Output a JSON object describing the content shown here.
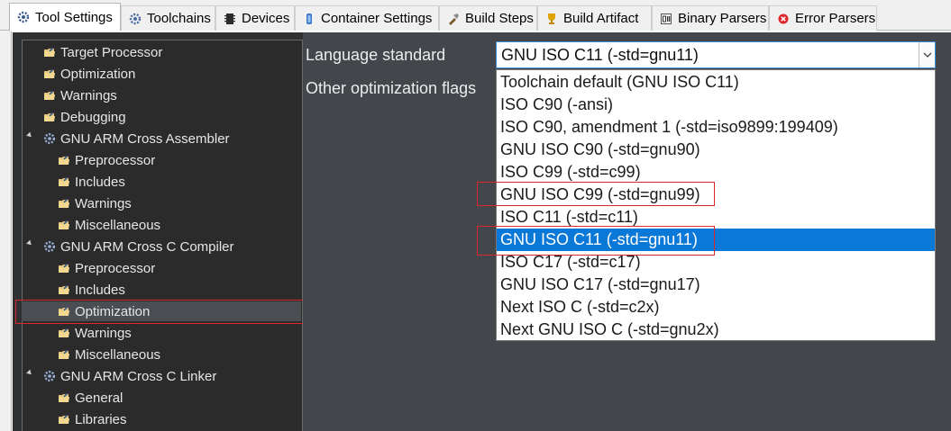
{
  "tabs": [
    {
      "label": "Tool Settings",
      "icon": "tool-settings-icon",
      "active": true
    },
    {
      "label": "Toolchains",
      "icon": "toolchains-icon"
    },
    {
      "label": "Devices",
      "icon": "devices-icon"
    },
    {
      "label": "Container Settings",
      "icon": "container-icon"
    },
    {
      "label": "Build Steps",
      "icon": "build-steps-icon"
    },
    {
      "label": "Build Artifact",
      "icon": "build-artifact-icon"
    },
    {
      "label": "Binary Parsers",
      "icon": "binary-parsers-icon"
    },
    {
      "label": "Error Parsers",
      "icon": "error-parsers-icon"
    }
  ],
  "tree": {
    "items": [
      {
        "label": "Target Processor",
        "level": 1
      },
      {
        "label": "Optimization",
        "level": 1
      },
      {
        "label": "Warnings",
        "level": 1
      },
      {
        "label": "Debugging",
        "level": 1
      },
      {
        "label": "GNU ARM Cross Assembler",
        "level": 0
      },
      {
        "label": "Preprocessor",
        "level": 2
      },
      {
        "label": "Includes",
        "level": 2
      },
      {
        "label": "Warnings",
        "level": 2
      },
      {
        "label": "Miscellaneous",
        "level": 2
      },
      {
        "label": "GNU ARM Cross C Compiler",
        "level": 0
      },
      {
        "label": "Preprocessor",
        "level": 2
      },
      {
        "label": "Includes",
        "level": 2
      },
      {
        "label": "Optimization",
        "level": 2,
        "selected": true
      },
      {
        "label": "Warnings",
        "level": 2
      },
      {
        "label": "Miscellaneous",
        "level": 2
      },
      {
        "label": "GNU ARM Cross C Linker",
        "level": 0
      },
      {
        "label": "General",
        "level": 2
      },
      {
        "label": "Libraries",
        "level": 2
      }
    ]
  },
  "form": {
    "language_standard_label": "Language standard",
    "other_flags_label": "Other optimization flags",
    "language_standard_value": "GNU ISO C11 (-std=gnu11)"
  },
  "dropdown": {
    "options": [
      "Toolchain default (GNU ISO C11)",
      "ISO C90 (-ansi)",
      "ISO C90, amendment 1 (-std=iso9899:199409)",
      "GNU ISO C90 (-std=gnu90)",
      "ISO C99 (-std=c99)",
      "GNU ISO C99 (-std=gnu99)",
      "ISO C11 (-std=c11)",
      "GNU ISO C11 (-std=gnu11)",
      "ISO C17 (-std=c17)",
      "GNU ISO C17 (-std=gnu17)",
      "Next ISO C (-std=c2x)",
      "Next GNU ISO C (-std=gnu2x)"
    ],
    "highlighted_index": 7
  },
  "colors": {
    "selection_blue": "#0a78d7",
    "annotation_red": "#d9272d",
    "panel_dark": "#43474c",
    "tree_dark": "#2b2b2b"
  }
}
